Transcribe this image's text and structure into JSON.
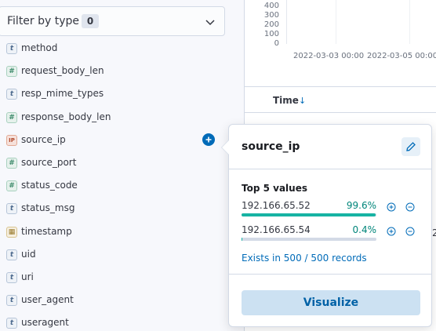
{
  "sidebar": {
    "filter": {
      "label": "Filter by type",
      "count": "0"
    },
    "fields": [
      {
        "name": "method",
        "type": "string",
        "token": "t"
      },
      {
        "name": "request_body_len",
        "type": "number",
        "token": "#"
      },
      {
        "name": "resp_mime_types",
        "type": "string",
        "token": "t"
      },
      {
        "name": "response_body_len",
        "type": "number",
        "token": "#"
      },
      {
        "name": "source_ip",
        "type": "ip",
        "token": "IP"
      },
      {
        "name": "source_port",
        "type": "number",
        "token": "#"
      },
      {
        "name": "status_code",
        "type": "number",
        "token": "#"
      },
      {
        "name": "status_msg",
        "type": "string",
        "token": "t"
      },
      {
        "name": "timestamp",
        "type": "date",
        "token": "▦"
      },
      {
        "name": "uid",
        "type": "string",
        "token": "t"
      },
      {
        "name": "uri",
        "type": "string",
        "token": "t"
      },
      {
        "name": "user_agent",
        "type": "string",
        "token": "t"
      },
      {
        "name": "useragent",
        "type": "string",
        "token": "t"
      }
    ]
  },
  "histogram": {
    "y_ticks": [
      "400",
      "300",
      "200",
      "100",
      "0"
    ],
    "x_ticks": [
      "2022-03-03 00:00",
      "2022-03-05 00:00"
    ]
  },
  "table": {
    "time_header": "Time",
    "sort_icon": "arrow-down-icon",
    "partial_cell": "2"
  },
  "popover": {
    "field": "source_ip",
    "top_values_title": "Top 5 values",
    "values": [
      {
        "ip": "192.166.65.52",
        "percent": "99.6%",
        "fraction": 0.996
      },
      {
        "ip": "192.166.65.54",
        "percent": "0.4%",
        "fraction": 0.004
      }
    ],
    "exists_text": "Exists in 500 / 500 records",
    "visualize_label": "Visualize"
  },
  "colors": {
    "primary": "#006bb8",
    "success": "#17b3a3",
    "visualize_bg": "#cce1f2"
  }
}
